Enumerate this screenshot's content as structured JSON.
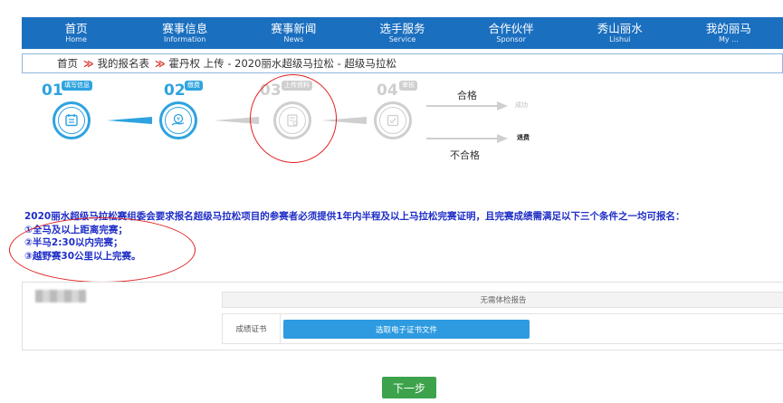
{
  "nav": {
    "items": [
      {
        "zh": "首页",
        "en": "Home"
      },
      {
        "zh": "赛事信息",
        "en": "Information"
      },
      {
        "zh": "赛事新闻",
        "en": "News"
      },
      {
        "zh": "选手服务",
        "en": "Service"
      },
      {
        "zh": "合作伙伴",
        "en": "Sponsor"
      },
      {
        "zh": "秀山丽水",
        "en": "Lishui"
      },
      {
        "zh": "我的丽马",
        "en": "My ..."
      }
    ]
  },
  "breadcrumb": {
    "home": "首页",
    "sep": "≫",
    "my_forms": "我的报名表",
    "current": "霍丹权 上传 - 2020丽水超级马拉松 - 超级马拉松"
  },
  "steps": [
    {
      "num": "01",
      "badge": "填写信息"
    },
    {
      "num": "02",
      "badge": "缴费"
    },
    {
      "num": "03",
      "badge": "上传资料"
    },
    {
      "num": "04",
      "badge": "审核"
    }
  ],
  "results": {
    "pass_label": "合格",
    "pass_tag": "成功",
    "fail_label": "不合格",
    "fail_tag": "退费"
  },
  "notice": {
    "line1": "2020丽水超级马拉松赛组委会要求报名超级马拉松项目的参赛者必须提供1年内半程及以上马拉松完赛证明，且完赛成绩需满足以下三个条件之一均可报名：",
    "line2": "①全马及以上距离完赛；",
    "line3": "②半马2:30以内完赛；",
    "line4": "③越野赛30公里以上完赛。"
  },
  "form": {
    "no_exam": "无需体检报告",
    "cert_label": "成绩证书",
    "upload_label": "选取电子证书文件"
  },
  "next_button": "下一步",
  "colors": {
    "nav": "#1b6fbf",
    "accent": "#2ea3df",
    "notice": "#1f2ec7",
    "next": "#3ca34c",
    "annotation": "#e02020"
  }
}
